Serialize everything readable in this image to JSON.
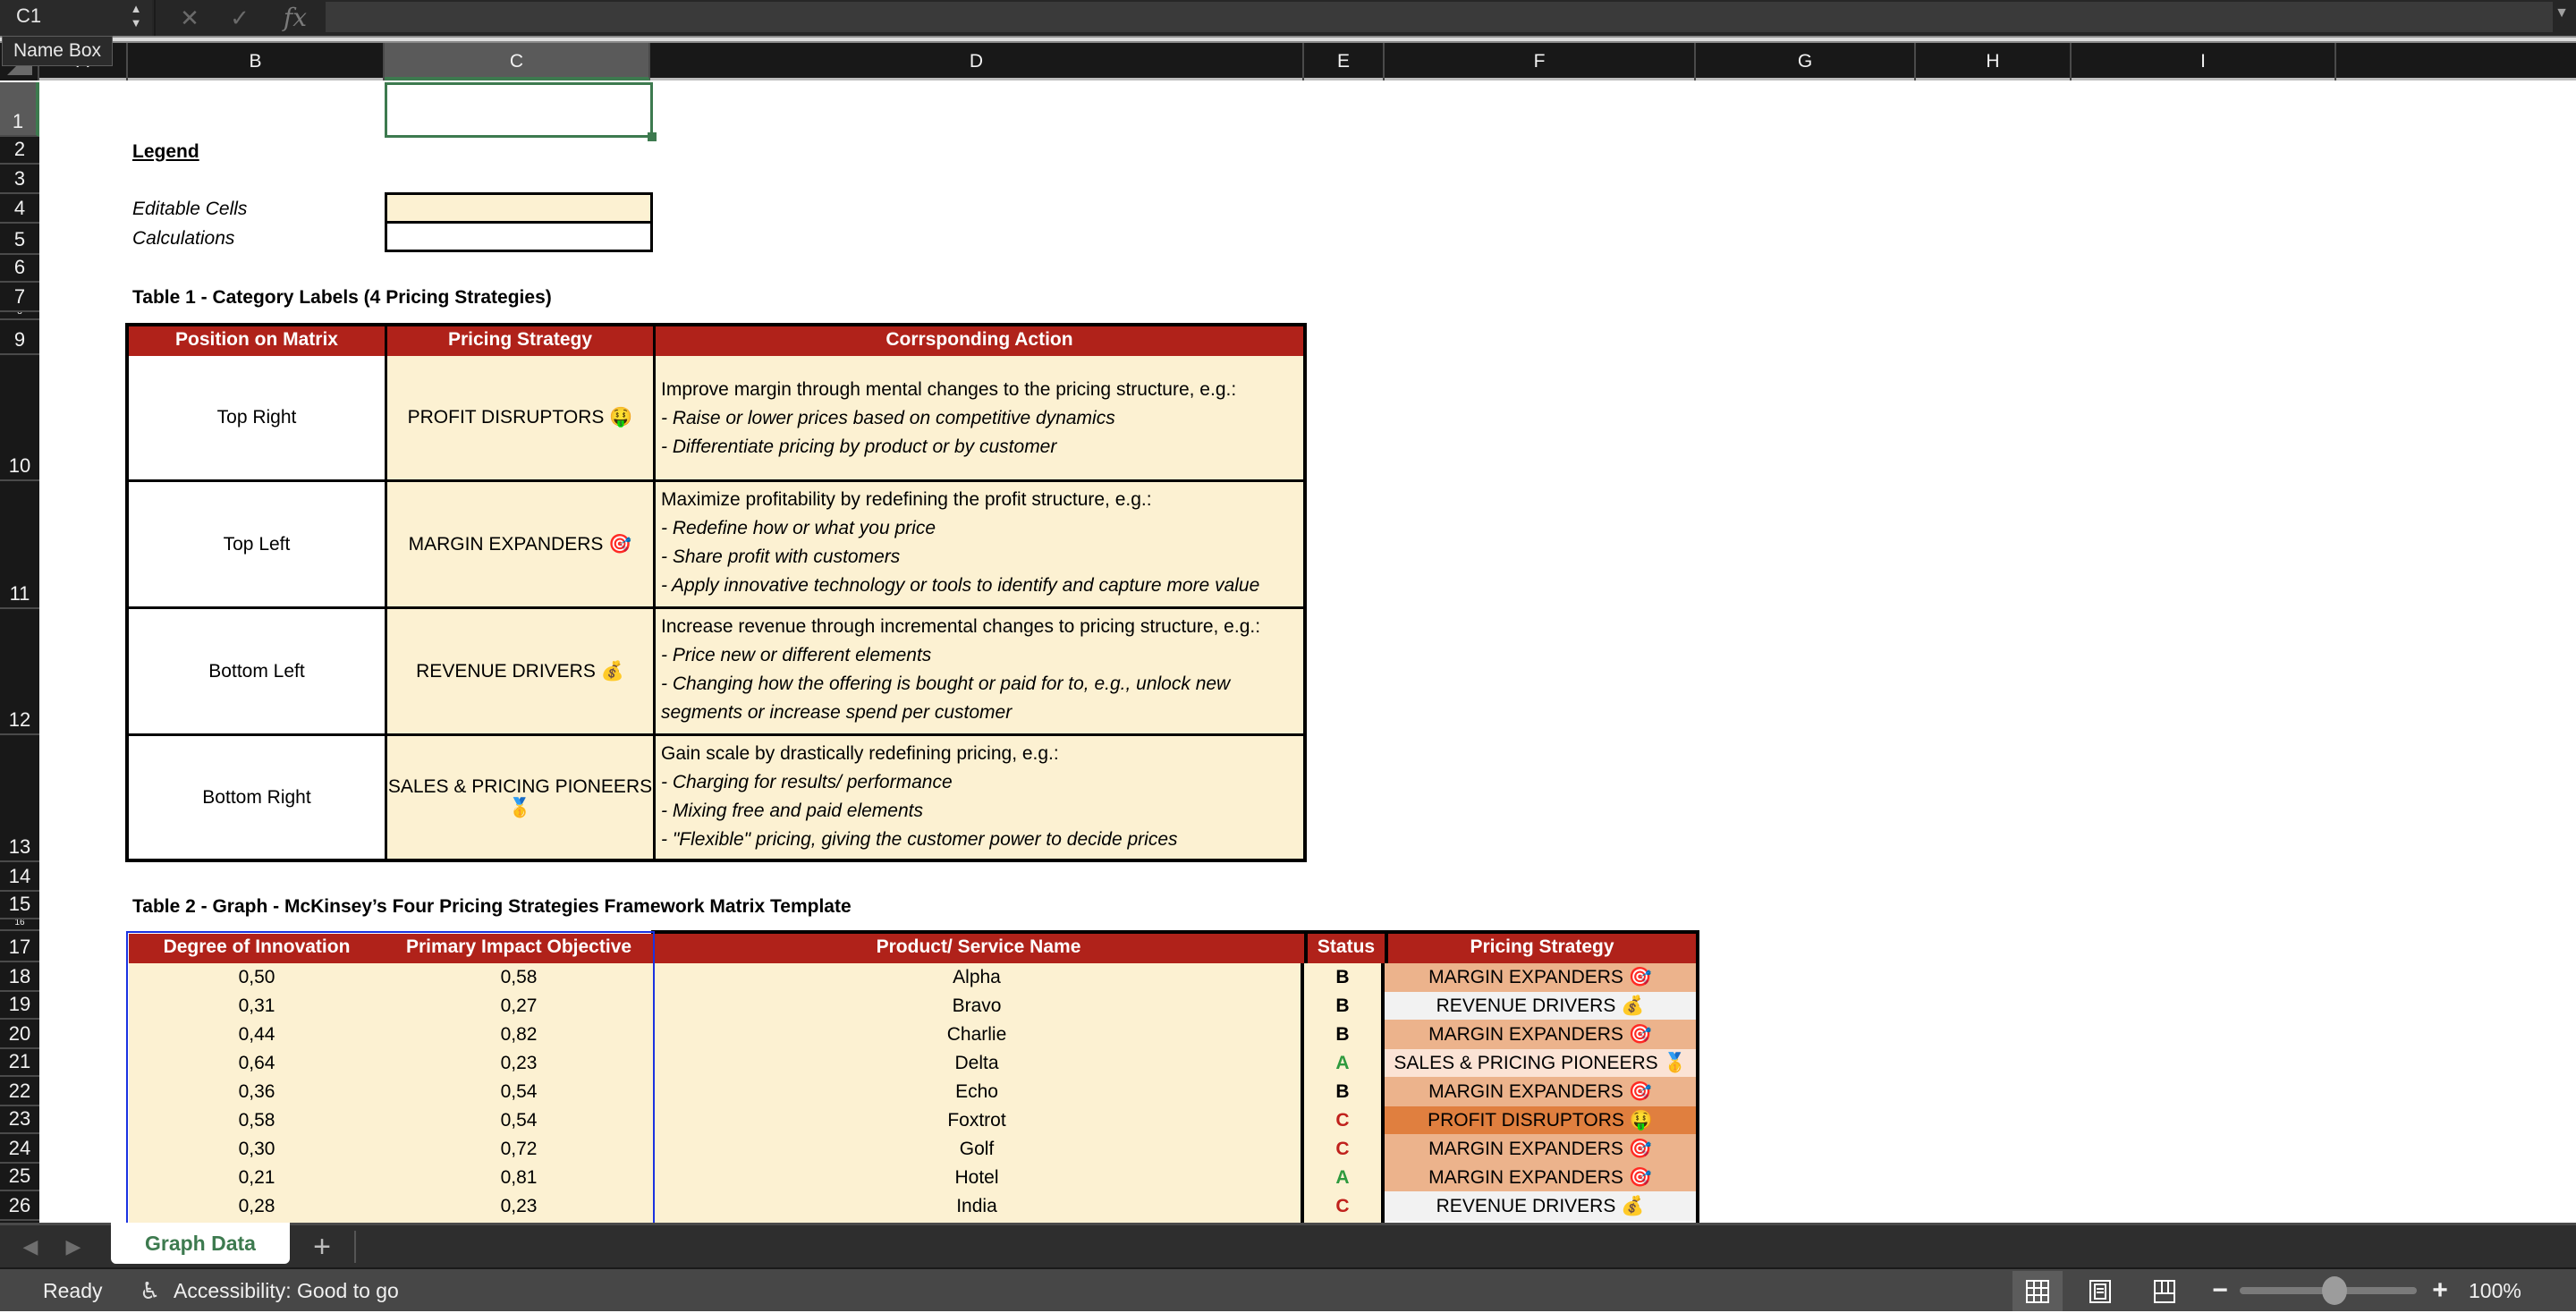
{
  "formula_bar": {
    "name_box": "C1",
    "tooltip": "Name Box",
    "cancel_icon": "x-icon",
    "enter_icon": "check-icon",
    "function_label": "fx",
    "formula_value": ""
  },
  "columns": [
    "A",
    "B",
    "C",
    "D",
    "E",
    "F",
    "G",
    "H",
    "I"
  ],
  "selected_column": "C",
  "rows": [
    "1",
    "2",
    "3",
    "4",
    "5",
    "6",
    "7",
    "8",
    "9",
    "10",
    "11",
    "12",
    "13",
    "14",
    "15",
    "16",
    "17",
    "18",
    "19",
    "20",
    "21",
    "22",
    "23",
    "24",
    "25",
    "26"
  ],
  "selected_row": "1",
  "legend": {
    "title": "Legend",
    "editable_label": "Editable Cells",
    "calculations_label": "Calculations"
  },
  "table1": {
    "title": "Table 1 - Category Labels (4 Pricing Strategies)",
    "headers": [
      "Position on Matrix",
      "Pricing Strategy",
      "Corrsponding Action"
    ],
    "rows": [
      {
        "position": "Top Right",
        "strategy": "PROFIT DISRUPTORS",
        "emoji": "🤑",
        "action_intro": "Improve margin through mental changes to the pricing structure, e.g.:",
        "action_points": [
          "- Raise or lower prices based on competitive dynamics",
          "- Differentiate pricing by product or by customer"
        ]
      },
      {
        "position": "Top Left",
        "strategy": "MARGIN EXPANDERS",
        "emoji": "🎯",
        "action_intro": "Maximize profitability by redefining the profit structure, e.g.:",
        "action_points": [
          "- Redefine how or what you price",
          "- Share profit with customers",
          "- Apply innovative technology or tools to identify and capture more value"
        ]
      },
      {
        "position": "Bottom Left",
        "strategy": "REVENUE DRIVERS",
        "emoji": "💰",
        "action_intro": "Increase revenue through incremental changes to pricing structure, e.g.:",
        "action_points": [
          "- Price new or different elements",
          "- Changing how the offering is bought or paid for to, e.g., unlock new segments or increase spend per customer"
        ]
      },
      {
        "position": "Bottom Right",
        "strategy": "SALES & PRICING PIONEERS",
        "emoji": "🥇",
        "action_intro": "Gain scale by drastically redefining pricing, e.g.:",
        "action_points": [
          "- Charging for results/ performance",
          "- Mixing free and paid elements",
          "- \"Flexible\" pricing, giving the customer power to decide prices"
        ]
      }
    ]
  },
  "table2": {
    "title": "Table 2 - Graph - McKinsey’s Four Pricing Strategies Framework Matrix Template",
    "headers": [
      "Degree of Innovation",
      "Primary Impact Objective",
      "Product/ Service Name",
      "Status",
      "Pricing Strategy"
    ],
    "rows": [
      {
        "innovation": "0,50",
        "impact": "0,58",
        "name": "Alpha",
        "status": "B",
        "strategy": "MARGIN EXPANDERS 🎯"
      },
      {
        "innovation": "0,31",
        "impact": "0,27",
        "name": "Bravo",
        "status": "B",
        "strategy": "REVENUE DRIVERS 💰"
      },
      {
        "innovation": "0,44",
        "impact": "0,82",
        "name": "Charlie",
        "status": "B",
        "strategy": "MARGIN EXPANDERS 🎯"
      },
      {
        "innovation": "0,64",
        "impact": "0,23",
        "name": "Delta",
        "status": "A",
        "strategy": "SALES & PRICING PIONEERS 🥇"
      },
      {
        "innovation": "0,36",
        "impact": "0,54",
        "name": "Echo",
        "status": "B",
        "strategy": "MARGIN EXPANDERS 🎯"
      },
      {
        "innovation": "0,58",
        "impact": "0,54",
        "name": "Foxtrot",
        "status": "C",
        "strategy": "PROFIT DISRUPTORS 🤑"
      },
      {
        "innovation": "0,30",
        "impact": "0,72",
        "name": "Golf",
        "status": "C",
        "strategy": "MARGIN EXPANDERS 🎯"
      },
      {
        "innovation": "0,21",
        "impact": "0,81",
        "name": "Hotel",
        "status": "A",
        "strategy": "MARGIN EXPANDERS 🎯"
      },
      {
        "innovation": "0,28",
        "impact": "0,23",
        "name": "India",
        "status": "C",
        "strategy": "REVENUE DRIVERS 💰"
      }
    ]
  },
  "colors": {
    "header_red": "#b0221a",
    "editable_cream": "#fcf1d2",
    "profit_disruptors": "#e07f3f",
    "margin_expanders": "#ecb38c",
    "revenue_drivers": "#f2f2f2",
    "sales_pricing_pioneers": "#fbe3d5",
    "status_A": "#2e9a3e",
    "status_B": "#000000",
    "status_C": "#c0211c",
    "selection_green": "#3d7a4f"
  },
  "sheet_tabs": {
    "active": "Graph Data",
    "add_label": "+"
  },
  "status_bar": {
    "ready": "Ready",
    "accessibility": "Accessibility: Good to go",
    "zoom_level": "100%",
    "zoom_fraction": 0.5,
    "zoom_minus": "−",
    "zoom_plus": "+"
  }
}
